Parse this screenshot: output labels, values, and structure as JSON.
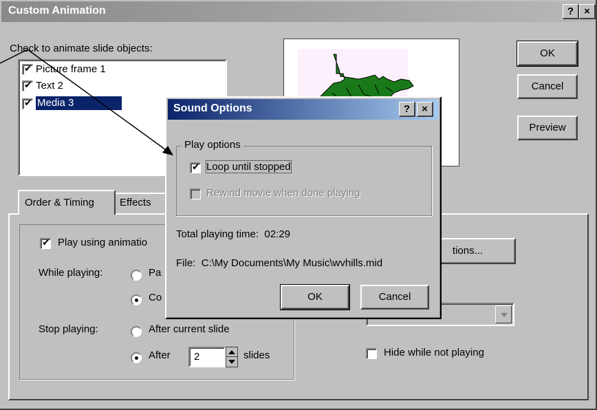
{
  "custom_animation": {
    "title": "Custom Animation",
    "help_button": "?",
    "close_button": "×",
    "check_label": "Check to animate slide objects:",
    "objects": [
      {
        "label": "Picture frame 1",
        "checked": true
      },
      {
        "label": "Text 2",
        "checked": true
      },
      {
        "label": "Media 3",
        "checked": true,
        "selected": true
      }
    ],
    "ok_label": "OK",
    "cancel_label": "Cancel",
    "preview_label": "Preview",
    "tabs": {
      "order_timing": "Order & Timing",
      "effects": "Effects"
    },
    "play_using_label": "Play using animatio",
    "while_playing_label": "While playing:",
    "while_opt1": "Pa",
    "while_opt2": "Co",
    "stop_playing_label": "Stop playing:",
    "stop_opt1": "After current slide",
    "stop_opt2": "After",
    "slides_count": "2",
    "slides_label": "slides",
    "more_options_label": "tions...",
    "hide_label": "Hide while not playing"
  },
  "sound_options": {
    "title": "Sound Options",
    "help_button": "?",
    "close_button": "×",
    "group_label": "Play options",
    "loop_label": "Loop until stopped",
    "loop_checked": true,
    "rewind_label": "Rewind movie when done playing",
    "rewind_checked": false,
    "total_label": "Total playing time:",
    "total_value": "02:29",
    "file_label": "File:",
    "file_value": "C:\\My Documents\\My Music\\wvhills.mid",
    "ok_label": "OK",
    "cancel_label": "Cancel"
  },
  "colors": {
    "active_title": "#0a246a",
    "inactive_title": "#8a8a8a",
    "face": "#c0c0c0",
    "selection": "#0a246a",
    "map_green": "#1a7a1a",
    "preview_bg": "#fdf0fd"
  }
}
